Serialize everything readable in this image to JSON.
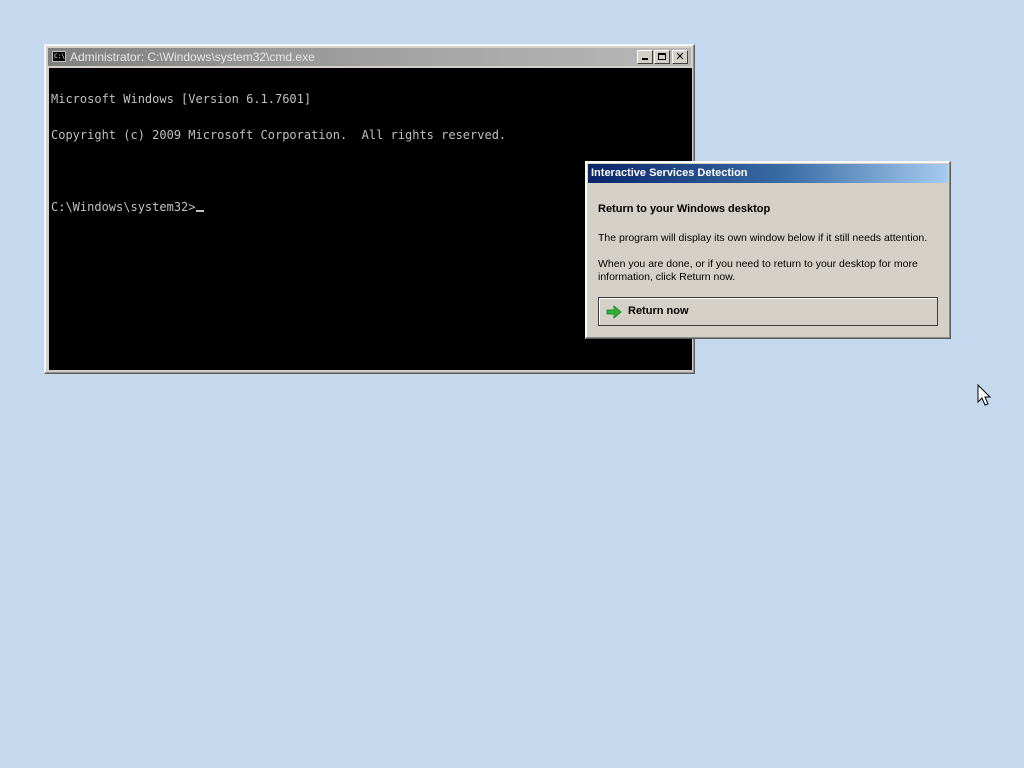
{
  "cmd_window": {
    "title": "Administrator: C:\\Windows\\system32\\cmd.exe",
    "icon_label": "C:\\",
    "console_lines": [
      "Microsoft Windows [Version 6.1.7601]",
      "Copyright (c) 2009 Microsoft Corporation.  All rights reserved.",
      "",
      "C:\\Windows\\system32>"
    ],
    "controls": {
      "minimize": "minimize-icon",
      "maximize": "maximize-icon",
      "close": "close-icon"
    }
  },
  "isd_dialog": {
    "title": "Interactive Services Detection",
    "heading": "Return to your Windows desktop",
    "message1": "The program will display its own window below if it still needs attention.",
    "message2": "When you are done, or if you need to return to your desktop for more information, click Return now.",
    "button_label": "Return now",
    "button_icon": "green-arrow-icon"
  },
  "colors": {
    "desktop": "#c5d9ee",
    "console_bg": "#000000",
    "console_text": "#c0c0c0",
    "dialog_title_start": "#0a246a",
    "dialog_title_end": "#a6caf0",
    "arrow_green": "#2eae34"
  }
}
